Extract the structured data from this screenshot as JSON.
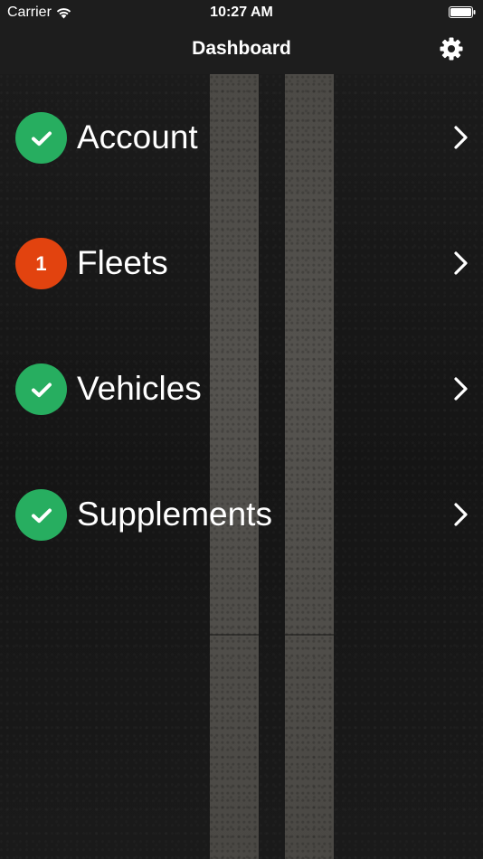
{
  "status_bar": {
    "carrier": "Carrier",
    "time": "10:27 AM",
    "wifi_icon": "wifi-icon",
    "battery_icon": "battery-icon"
  },
  "nav_bar": {
    "title": "Dashboard",
    "settings_icon": "gear-icon"
  },
  "menu": {
    "items": [
      {
        "label": "Account",
        "badge_type": "check",
        "badge_text": ""
      },
      {
        "label": "Fleets",
        "badge_type": "count",
        "badge_text": "1"
      },
      {
        "label": "Vehicles",
        "badge_type": "check",
        "badge_text": ""
      },
      {
        "label": "Supplements",
        "badge_type": "check",
        "badge_text": ""
      }
    ]
  },
  "colors": {
    "bar_background": "#1d1d1d",
    "status_ok": "#27ae60",
    "status_alert": "#e2430f",
    "text": "#ffffff",
    "road_stripe": "#4f4d49"
  }
}
